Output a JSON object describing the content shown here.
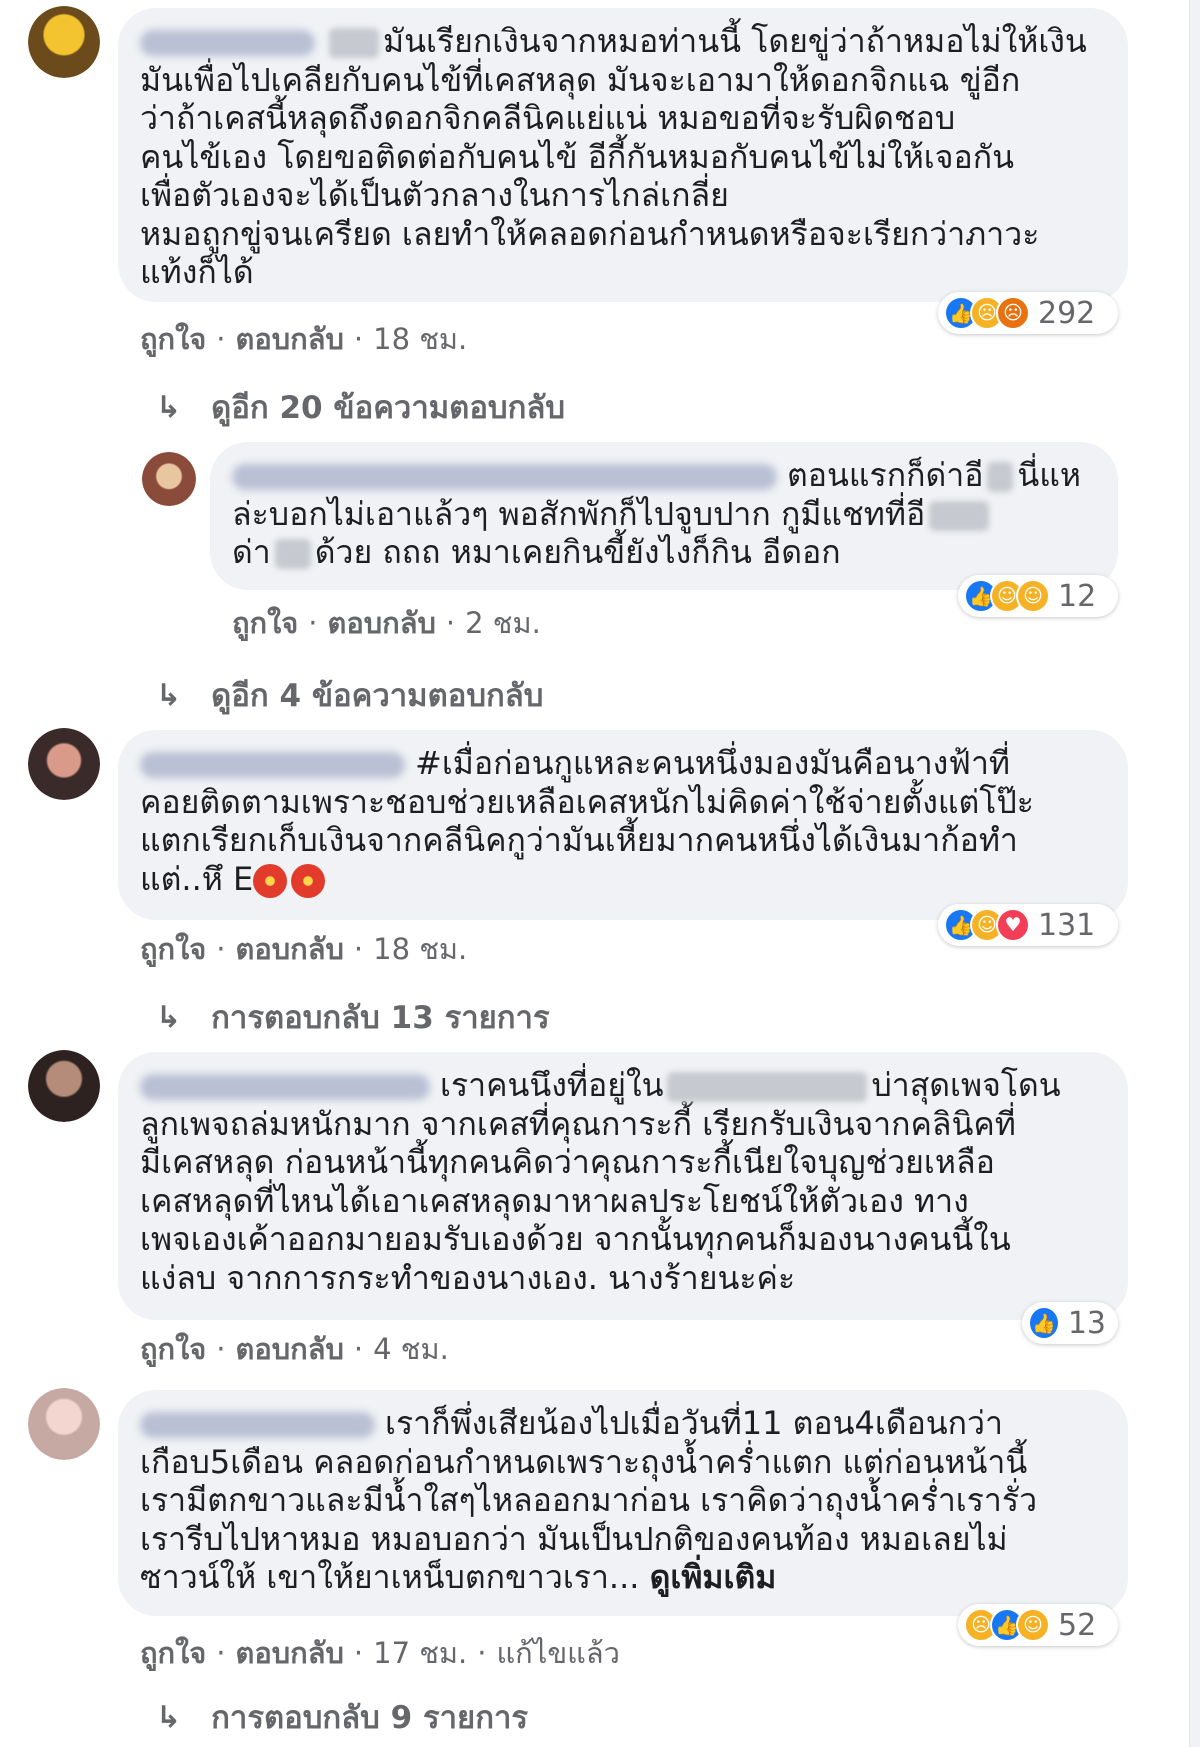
{
  "comments": [
    {
      "text_before_blur": "",
      "text_after_blur": "มันเรียกเงินจากหมอท่านนี้ โดยขู่ว่าถ้าหมอไม่ให้เงิน\nมันเพื่อไปเคลียกับคนไข้ที่เคสหลุด มันจะเอามาให้ดอกจิกแฉ ขู่อีก\nว่าถ้าเคสนี้หลุดถึงดอกจิกคลีนิคแย่แน่ หมอขอที่จะรับผิดชอบ\nคนไข้เอง โดยขอติดต่อกับคนไข้ อีกี้กันหมอกับคนไข้ไม่ให้เจอกัน\nเพื่อตัวเองจะได้เป็นตัวกลางในการไกล่เกลี่ย\nหมอถูกขู่จนเครียด เลยทำให้คลอดก่อนกำหนดหรือจะเรียกว่าภาวะ\nแท้งก็ได้",
      "reaction_count": "292",
      "reactions": [
        "like-icon",
        "sad-icon",
        "angry-icon"
      ],
      "like": "ถูกใจ",
      "reply": "ตอบกลับ",
      "time": "18 ชม.",
      "replies_label": "ดูอีก 20 ข้อความตอบกลับ"
    },
    {
      "text_first": "ตอนแรกก็ด่าอี",
      "text_second": "นี่แห\nล่ะบอกไม่เอาแล้วๆ พอสักพักก็ไปจูบปาก กูมีแชทที่อี",
      "text_third": "\nด่า",
      "text_fourth": "ด้วย ถถถ หมาเคยกินขี้ยังไงก็กิน อีดอก",
      "reaction_count": "12",
      "reactions": [
        "like-icon",
        "haha-icon",
        "wow-icon"
      ],
      "like": "ถูกใจ",
      "reply": "ตอบกลับ",
      "time": "2 ชม.",
      "replies_label": "ดูอีก 4 ข้อความตอบกลับ"
    },
    {
      "text": "#เมื่อก่อนกูแหละคนหนึ่งมองมันคือนางฟ้าที่\nคอยติดตามเพราะชอบช่วยเหลือเคสหนักไม่คิดค่าใช้จ่ายตั้งแต่โป๊ะ\nแตกเรียกเก็บเงินจากคลีนิคกูว่ามันเหี้ยมากคนหนึ่งได้เงินมาก้อทำ\nแต่..หึ E",
      "reaction_count": "131",
      "reactions": [
        "like-icon",
        "haha-icon",
        "love-icon"
      ],
      "like": "ถูกใจ",
      "reply": "ตอบกลับ",
      "time": "18 ชม.",
      "replies_label": "การตอบกลับ 13 รายการ"
    },
    {
      "text_first": "เราคนนึงที่อยู่ใน",
      "text_second": "บ่าสุดเพจโดน\nลูกเพจถล่มหนักมาก จากเคสที่คุณการะกี้ เรียกรับเงินจากคลินิคที่\nมีเคสหลุด ก่อนหน้านี้ทุกคนคิดว่าคุณการะกี้เนียใจบุญช่วยเหลือ\nเคสหลุดที่ไหนได้เอาเคสหลุดมาหาผลประโยชน์ให้ตัวเอง ทาง\nเพจเองเค้าออกมายอมรับเองด้วย จากนั้นทุกคนก็มองนางคนนี้ใน\nแง่ลบ จากการกระทำของนางเอง. นางร้ายนะค่ะ",
      "reaction_count": "13",
      "reactions": [
        "like-icon"
      ],
      "like": "ถูกใจ",
      "reply": "ตอบกลับ",
      "time": "4 ชม."
    },
    {
      "text": "เราก็พึ่งเสียน้องไปเมื่อวันที่11 ตอน4เดือนกว่า\nเกือบ5เดือน คลอดก่อนกำหนดเพราะถุงน้ำคร่ำแตก แต่ก่อนหน้านี้\nเรามีตกขาวและมีน้ำใสๆไหลออกมาก่อน เราคิดว่าถุงน้ำคร่ำเรารั่ว\nเรารีบไปหาหมอ หมอบอกว่า มันเป็นปกติของคนท้อง หมอเลยไม่\nซาวน์ให้ เขาให้ยาเหน็บตกขาวเรา...",
      "see_more": "ดูเพิ่มเติม",
      "reaction_count": "52",
      "reactions": [
        "sad-icon",
        "like-icon",
        "wow-icon"
      ],
      "like": "ถูกใจ",
      "reply": "ตอบกลับ",
      "time": "17 ชม.",
      "edited": "แก้ไขแล้ว",
      "replies_label": "การตอบกลับ 9 รายการ"
    }
  ],
  "colors": {
    "bubble": "#f0f2f5",
    "meta_text": "#65676b",
    "like_blue": "#1877f2",
    "reaction_yellow": "#f7b125",
    "reaction_orange": "#e9710f",
    "reaction_red": "#f33e58"
  }
}
